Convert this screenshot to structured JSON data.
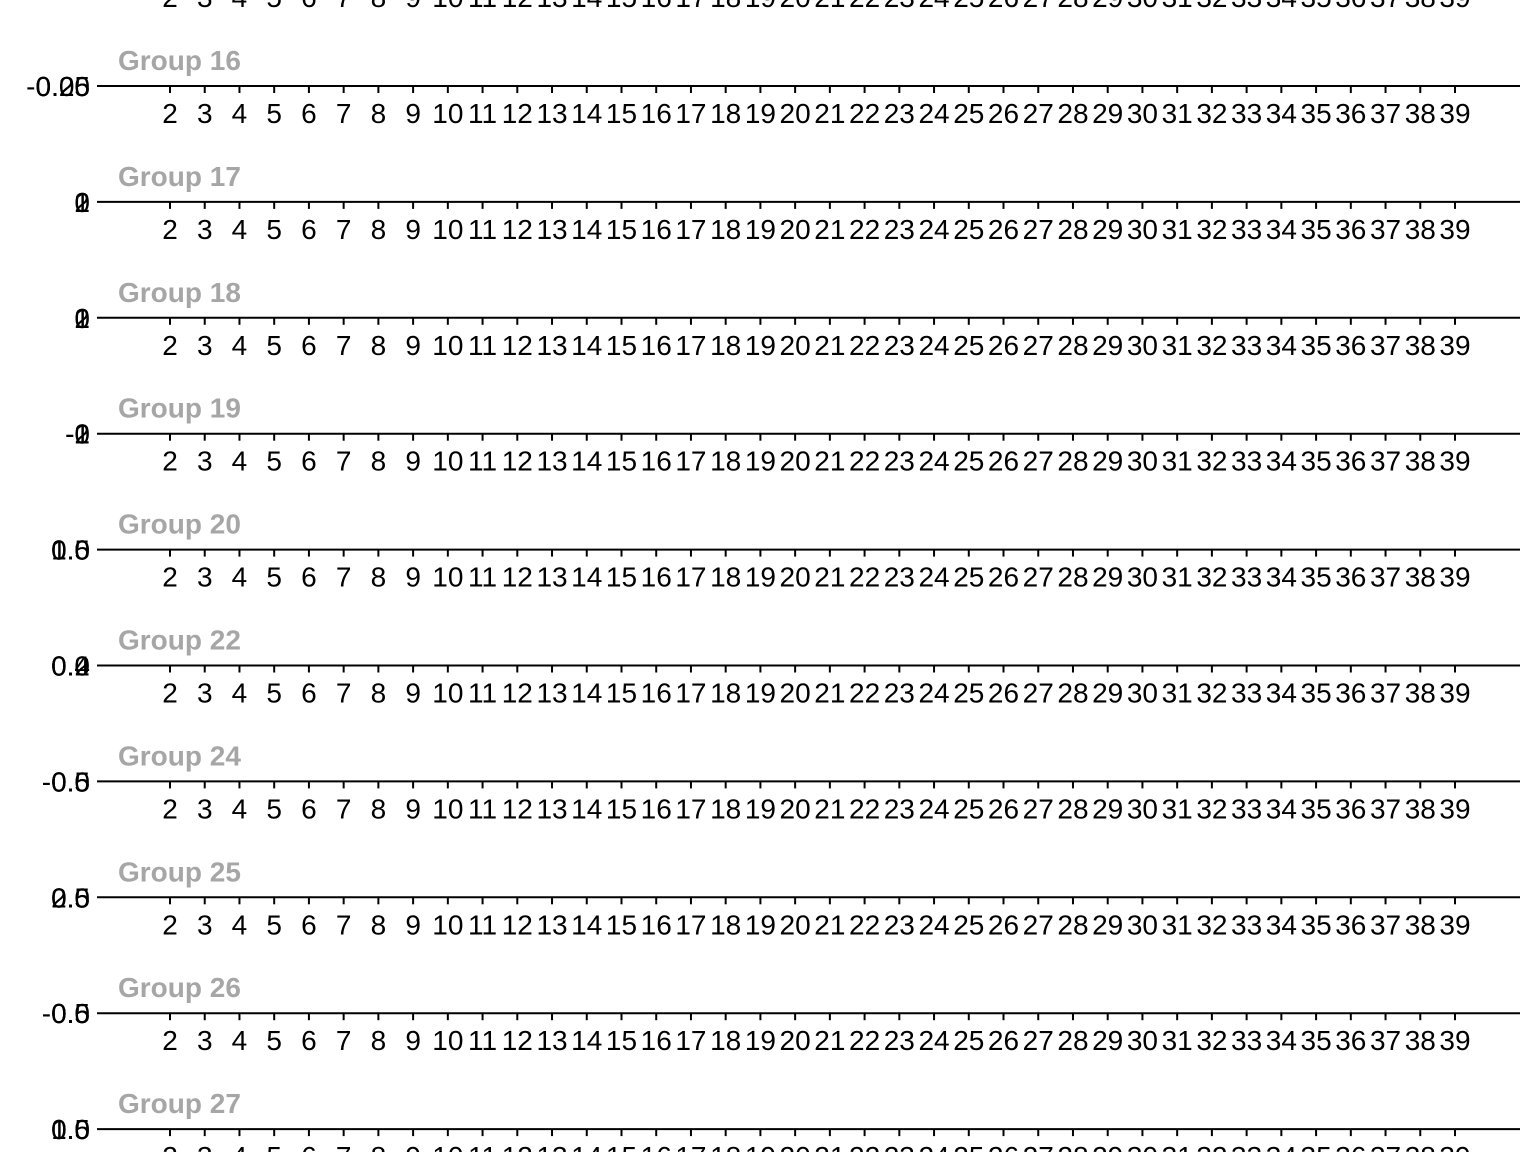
{
  "chart_data": {
    "type": "line",
    "layout": "small-multiples, one panel per group, stacked vertically",
    "x_categories": [
      "2",
      "3",
      "4",
      "5",
      "6",
      "7",
      "8",
      "9",
      "10",
      "11",
      "12",
      "13",
      "14",
      "15",
      "16",
      "17",
      "18",
      "19",
      "20",
      "21",
      "22",
      "23",
      "24",
      "25",
      "26",
      "27",
      "28",
      "29",
      "30",
      "31",
      "32",
      "33",
      "34",
      "35",
      "36",
      "37",
      "38",
      "39"
    ],
    "partial_top_panel": {
      "x_tick_labels_visible": true
    },
    "panels": [
      {
        "title": "Group 16",
        "y_tick_labels": [
          "-0.25",
          "0.00",
          "0.25"
        ]
      },
      {
        "title": "Group 17",
        "y_tick_labels": [
          "0",
          "1",
          "2"
        ]
      },
      {
        "title": "Group 18",
        "y_tick_labels": [
          "0",
          "1",
          "2"
        ]
      },
      {
        "title": "Group 19",
        "y_tick_labels": [
          "-2",
          "-1",
          "0"
        ]
      },
      {
        "title": "Group 20",
        "y_tick_labels": [
          "0.0",
          "0.5",
          "1.0"
        ]
      },
      {
        "title": "Group 22",
        "y_tick_labels": [
          "0.0",
          "0.2",
          "0.4"
        ]
      },
      {
        "title": "Group 24",
        "y_tick_labels": [
          "-0.5",
          "0.0",
          "0.5"
        ]
      },
      {
        "title": "Group 25",
        "y_tick_labels": [
          "0.0",
          "0.5",
          "2.5"
        ]
      },
      {
        "title": "Group 26",
        "y_tick_labels": [
          "-0.5",
          "0.0",
          "0.5"
        ]
      },
      {
        "title": "Group 27",
        "y_tick_labels": [
          "0.0",
          "0.5",
          "1.0"
        ]
      }
    ],
    "grid": false,
    "legend": "none",
    "colors": {
      "title": "#a6a6a6",
      "axis": "#000000",
      "background": "#ffffff"
    }
  }
}
